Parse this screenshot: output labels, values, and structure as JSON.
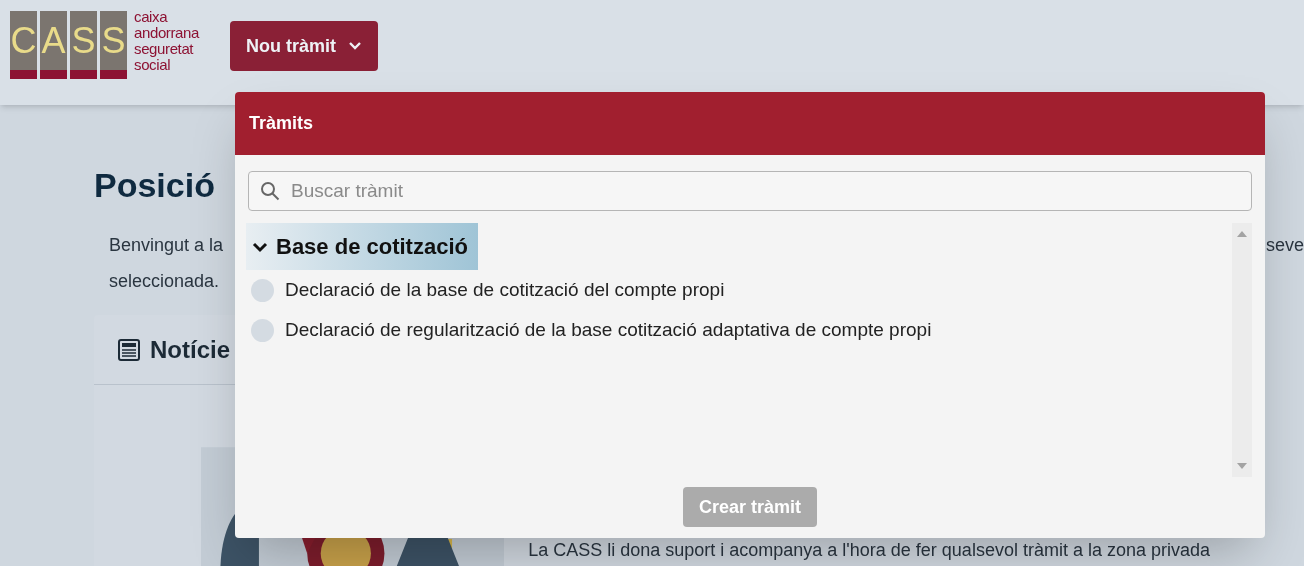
{
  "logo": {
    "letters": [
      "C",
      "A",
      "S",
      "S"
    ],
    "tagline": [
      "caixa",
      "andorrana",
      "seguretat",
      "social"
    ]
  },
  "new_button": {
    "label": "Nou tràmit",
    "expanded": true
  },
  "page": {
    "title": "Posició",
    "intro_left": [
      "Benvingut a la",
      "seleccionada."
    ],
    "intro_right": "seve",
    "card_title": "Notície",
    "card_text": "La CASS li dona suport i acompanya a l'hora de fer qualsevol tràmit a la zona privada"
  },
  "dropdown": {
    "title": "Tràmits",
    "search": {
      "placeholder": "Buscar tràmit"
    },
    "groups": [
      {
        "label": "Base de cotització",
        "expanded": true,
        "items": [
          {
            "label": "Declaració de la base de cotització del compte propi",
            "selected": false
          },
          {
            "label": "Declaració de regularització de la base cotització adaptativa de compte propi",
            "selected": false
          }
        ]
      }
    ],
    "create_button": {
      "label": "Crear tràmit",
      "disabled": true
    }
  }
}
